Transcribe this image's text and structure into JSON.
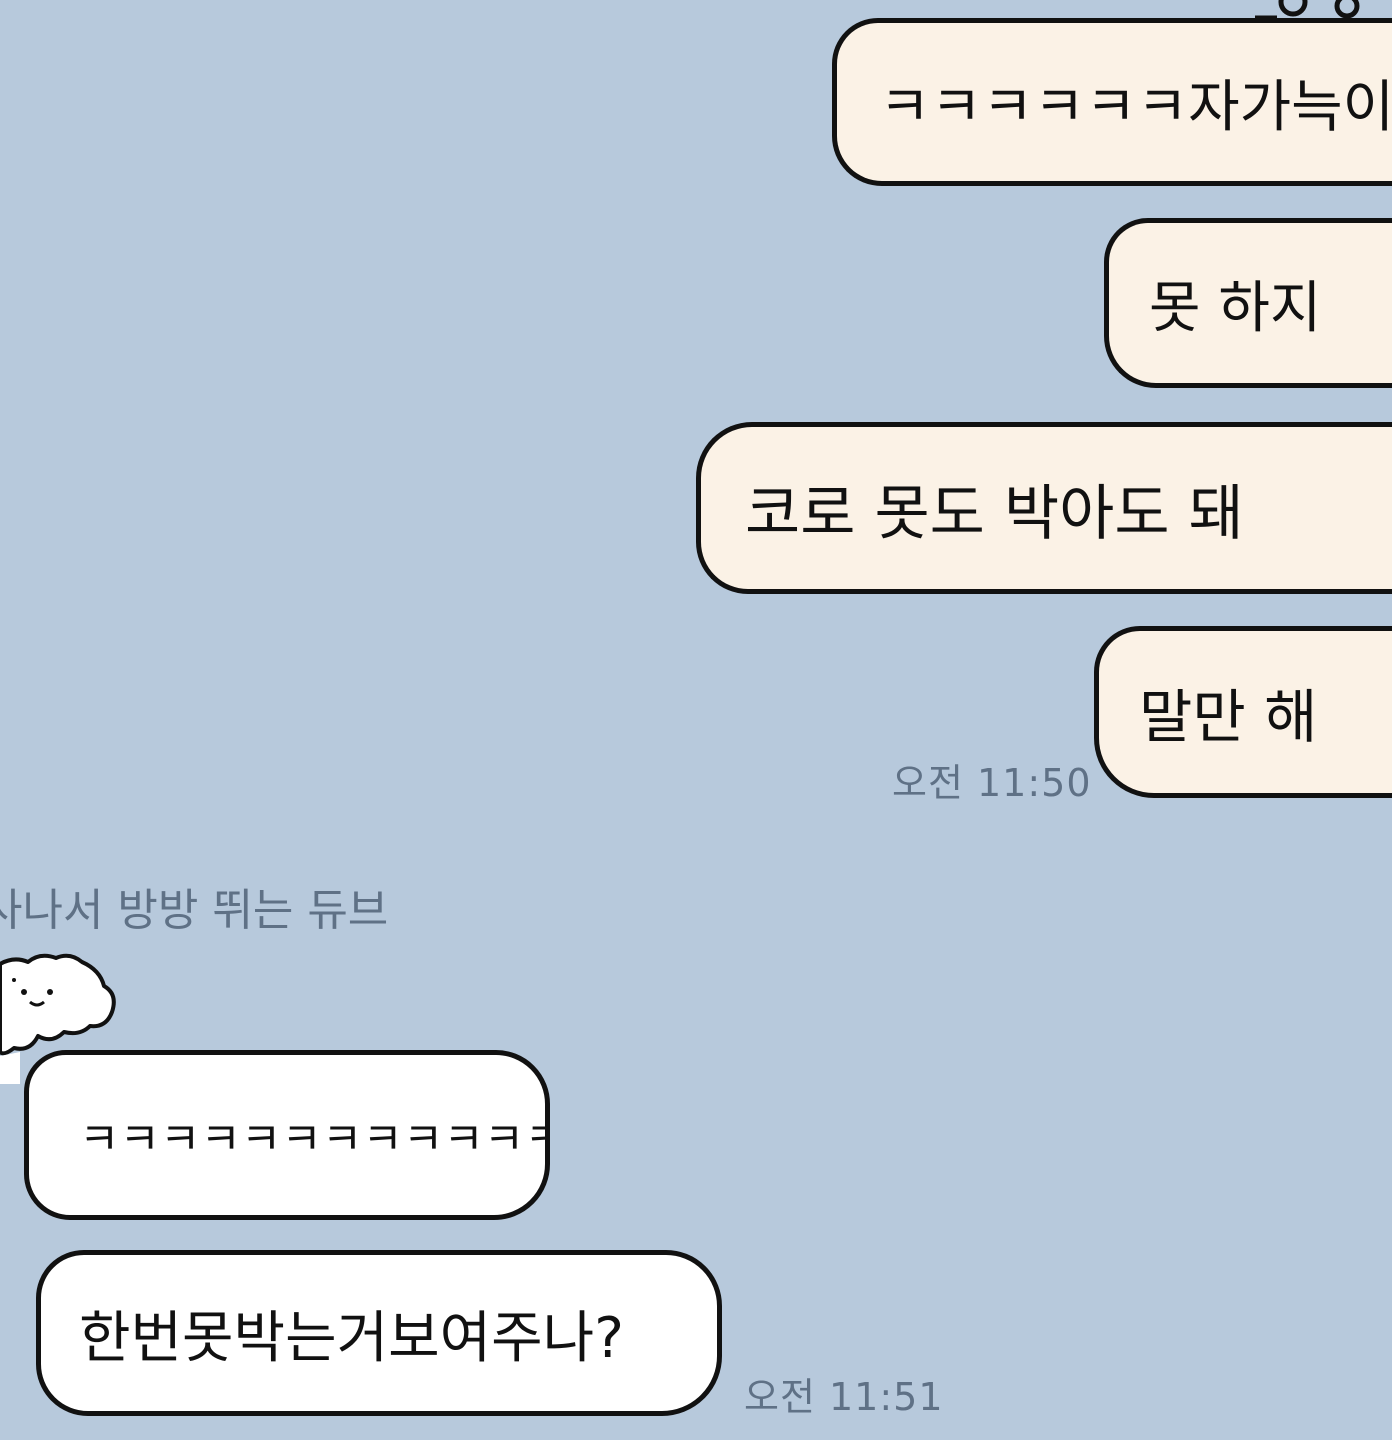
{
  "chat": {
    "sent_messages": [
      {
        "text": "ㅋㅋㅋㅋㅋㅋ자가늑이라"
      },
      {
        "text": "못 하지"
      },
      {
        "text": "코로 못도 박아도 돼"
      },
      {
        "text": "말만 해"
      }
    ],
    "sent_timestamp": "오전 11:50",
    "sender_name": "사나서 방방 뛰는 듀브",
    "received_messages": [
      {
        "text": "ㅋㅋㅋㅋㅋㅋㅋㅋㅋㅋㅋㅋ"
      },
      {
        "text": "한번못박는거보여주나?"
      }
    ],
    "received_timestamp": "오전 11:51",
    "avatar_icon": "cartoon-avatar-icon",
    "colors": {
      "background": "#b7c9dc",
      "sent_bubble": "#fbf2e6",
      "received_bubble": "#ffffff",
      "outline": "#111111",
      "meta_text": "#5f7186"
    }
  }
}
